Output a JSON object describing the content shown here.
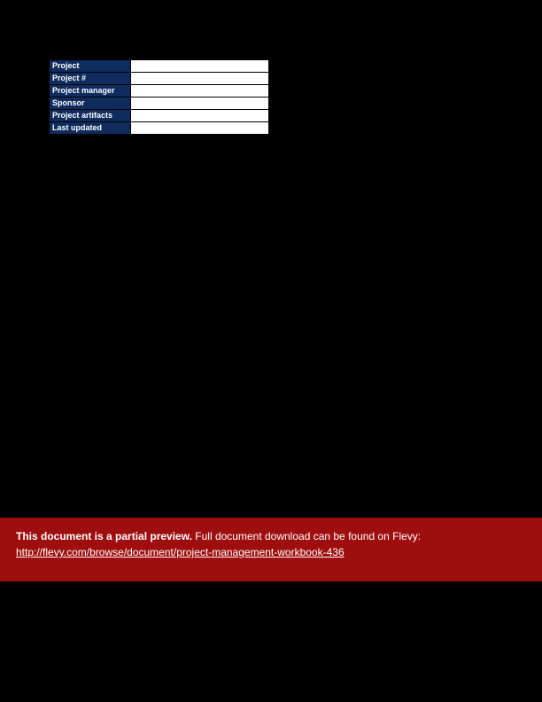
{
  "form": {
    "rows": [
      {
        "label": "Project",
        "value": ""
      },
      {
        "label": "Project #",
        "value": ""
      },
      {
        "label": "Project manager",
        "value": ""
      },
      {
        "label": "Sponsor",
        "value": ""
      },
      {
        "label": "Project artifacts",
        "value": ""
      },
      {
        "label": "Last updated",
        "value": ""
      }
    ]
  },
  "banner": {
    "bold": "This document is a partial preview.",
    "rest": "  Full document download can be found on Flevy:",
    "link_text": "http://flevy.com/browse/document/project-management-workbook-436",
    "link_href": "http://flevy.com/browse/document/project-management-workbook-436"
  }
}
